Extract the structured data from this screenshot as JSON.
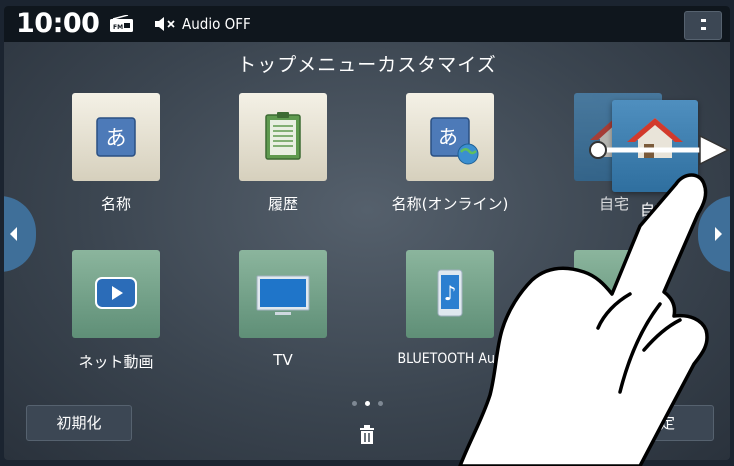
{
  "status": {
    "time": "10:00",
    "audio": "Audio OFF",
    "radio_icon": "radio-icon",
    "mute_icon": "mute-icon"
  },
  "title": "トップメニューカスタマイズ",
  "tiles": [
    {
      "label": "名称",
      "icon": "hiragana-a-icon"
    },
    {
      "label": "履歴",
      "icon": "history-document-icon"
    },
    {
      "label": "名称(オンライン)",
      "icon": "online-search-icon"
    },
    {
      "label": "自宅",
      "icon": "home-icon"
    },
    {
      "label": "ネット動画",
      "icon": "play-video-icon"
    },
    {
      "label": "TV",
      "icon": "tv-icon"
    },
    {
      "label": "BLUETOOTH Audi",
      "icon": "bluetooth-audio-icon"
    }
  ],
  "drag_label": "自宅",
  "buttons": {
    "reset": "初期化",
    "confirm": "決定"
  },
  "pagination": {
    "current": 2,
    "total": 3
  },
  "colors": {
    "accent": "#3f6f99",
    "background": "#3b4550"
  }
}
